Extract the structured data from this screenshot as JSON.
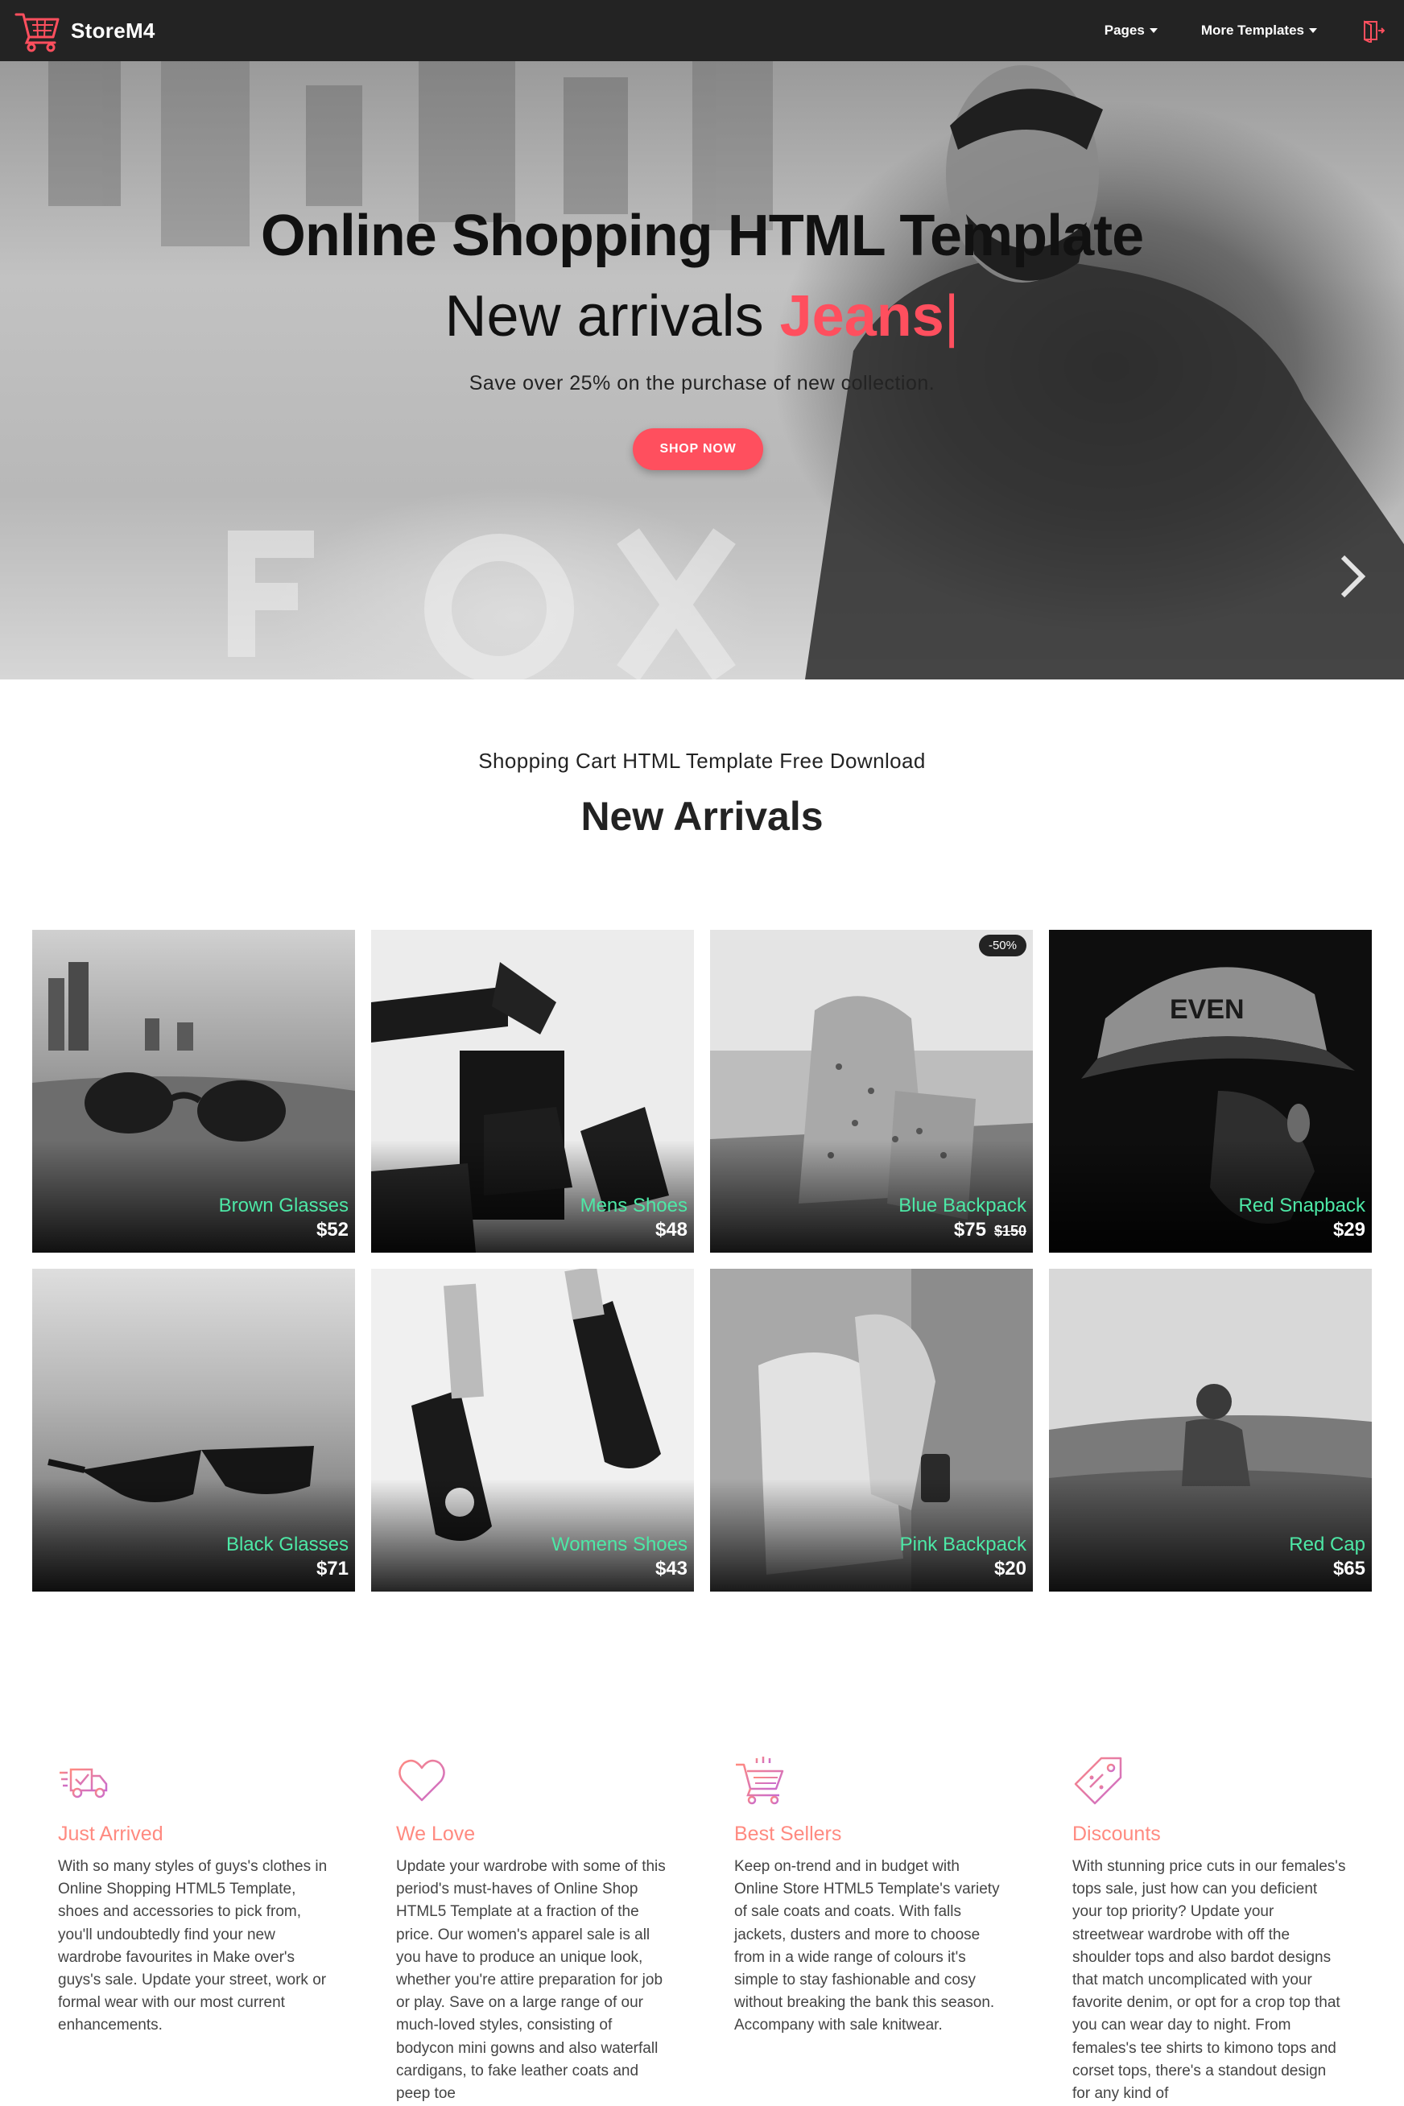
{
  "navbar": {
    "brand": "StoreM4",
    "menu": [
      {
        "label": "Pages"
      },
      {
        "label": "More Templates"
      }
    ],
    "accent_color": "#ff4f5e"
  },
  "hero": {
    "title": "Online Shopping HTML Template",
    "subtitle_prefix": "New arrivals ",
    "subtitle_accent": "Jeans",
    "cursor": "|",
    "description": "Save over 25% on the purchase of new collection.",
    "button": "SHOP NOW"
  },
  "arrivals": {
    "kicker": "Shopping Cart HTML Template Free Download",
    "title": "New Arrivals",
    "products": [
      {
        "name": "Brown Glasses",
        "price": "$52"
      },
      {
        "name": "Mens Shoes",
        "price": "$48"
      },
      {
        "name": "Blue Backpack",
        "price": "$75",
        "old_price": "$150",
        "badge": "-50%"
      },
      {
        "name": "Red Snapback",
        "price": "$29"
      },
      {
        "name": "Black Glasses",
        "price": "$71"
      },
      {
        "name": "Womens Shoes",
        "price": "$43"
      },
      {
        "name": "Pink Backpack",
        "price": "$20"
      },
      {
        "name": "Red Cap",
        "price": "$65"
      }
    ]
  },
  "features": [
    {
      "icon": "delivery-truck-icon",
      "title": "Just Arrived",
      "text": "With so many styles of guys's clothes in Online Shopping HTML5 Template, shoes and accessories to pick from, you'll undoubtedly find your new wardrobe favourites in Make over's guys's sale. Update your street, work or formal wear with our most current enhancements."
    },
    {
      "icon": "heart-icon",
      "title": "We Love",
      "text": "Update your wardrobe with some of this period's must-haves of Online Shop HTML5 Template at a fraction of the price. Our women's apparel sale is all you have to produce an unique look, whether you're attire preparation for job or play. Save on a large range of our much-loved styles, consisting of bodycon mini gowns and also waterfall cardigans, to fake leather coats and peep toe"
    },
    {
      "icon": "shopping-cart-icon",
      "title": "Best Sellers",
      "text": "Keep on-trend and in budget with Online Store HTML5 Template's variety of sale coats and coats. With falls jackets, dusters and more to choose from in a wide range of colours it's simple to stay fashionable and cosy without breaking the bank this season. Accompany with sale knitwear."
    },
    {
      "icon": "price-tag-icon",
      "title": "Discounts",
      "text": "With stunning price cuts in our females's tops sale, just how can you deficient your top priority? Update your streetwear wardrobe with off the shoulder tops and also bardot designs that match uncomplicated with your favorite denim, or opt for a crop top that you can wear day to night. From females's tee shirts to kimono tops and corset tops, there's a standout design for any kind of"
    }
  ]
}
